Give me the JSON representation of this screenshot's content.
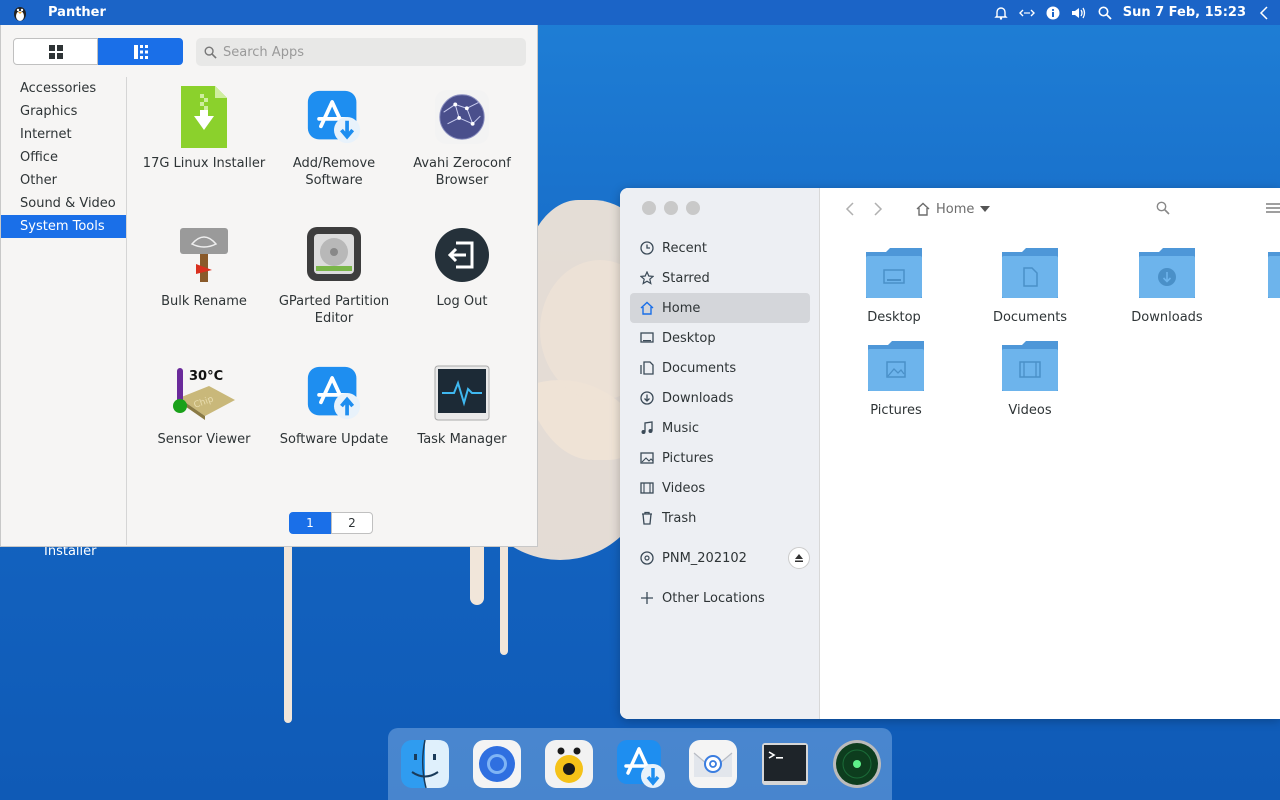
{
  "top_panel": {
    "app_name": "Panther",
    "datetime": "Sun  7 Feb, 15:23"
  },
  "app_menu": {
    "search_placeholder": "Search Apps",
    "categories": [
      "Accessories",
      "Graphics",
      "Internet",
      "Office",
      "Other",
      "Sound & Video",
      "System Tools"
    ],
    "active_category": "System Tools",
    "apps": [
      {
        "label": "17G Linux Installer",
        "icon": "installer-icon"
      },
      {
        "label": "Add/Remove Software",
        "icon": "add-remove-software-icon"
      },
      {
        "label": "Avahi Zeroconf Browser",
        "icon": "avahi-browser-icon"
      },
      {
        "label": "Bulk Rename",
        "icon": "bulk-rename-icon"
      },
      {
        "label": "GParted Partition Editor",
        "icon": "gparted-icon"
      },
      {
        "label": "Log Out",
        "icon": "log-out-icon"
      },
      {
        "label": "Sensor Viewer",
        "icon": "sensor-viewer-icon"
      },
      {
        "label": "Software Update",
        "icon": "software-update-icon"
      },
      {
        "label": "Task Manager",
        "icon": "task-manager-icon"
      }
    ],
    "sensor_temp": "30°C",
    "sensor_chip": "Chip",
    "pages": [
      "1",
      "2"
    ],
    "active_page": "1"
  },
  "desktop": {
    "icon_label": "Installer"
  },
  "file_manager": {
    "breadcrumb": "Home",
    "places": [
      {
        "label": "Recent",
        "icon": "clock-icon"
      },
      {
        "label": "Starred",
        "icon": "star-icon"
      },
      {
        "label": "Home",
        "icon": "home-icon"
      },
      {
        "label": "Desktop",
        "icon": "desktop-icon"
      },
      {
        "label": "Documents",
        "icon": "documents-icon"
      },
      {
        "label": "Downloads",
        "icon": "downloads-icon"
      },
      {
        "label": "Music",
        "icon": "music-icon"
      },
      {
        "label": "Pictures",
        "icon": "pictures-icon"
      },
      {
        "label": "Videos",
        "icon": "videos-icon"
      },
      {
        "label": "Trash",
        "icon": "trash-icon"
      }
    ],
    "active_place": "Home",
    "device": "PNM_202102",
    "other_locations": "Other Locations",
    "folders": [
      "Desktop",
      "Documents",
      "Downloads",
      "Pictures",
      "Videos"
    ]
  },
  "dock": {
    "apps": [
      "finder-icon",
      "browser-icon",
      "music-player-icon",
      "software-store-icon",
      "mail-icon",
      "terminal-icon",
      "radar-icon"
    ]
  },
  "colors": {
    "accent": "#1a6fe8",
    "panel": "#1b64c7",
    "folder": "#5aa9e6"
  }
}
